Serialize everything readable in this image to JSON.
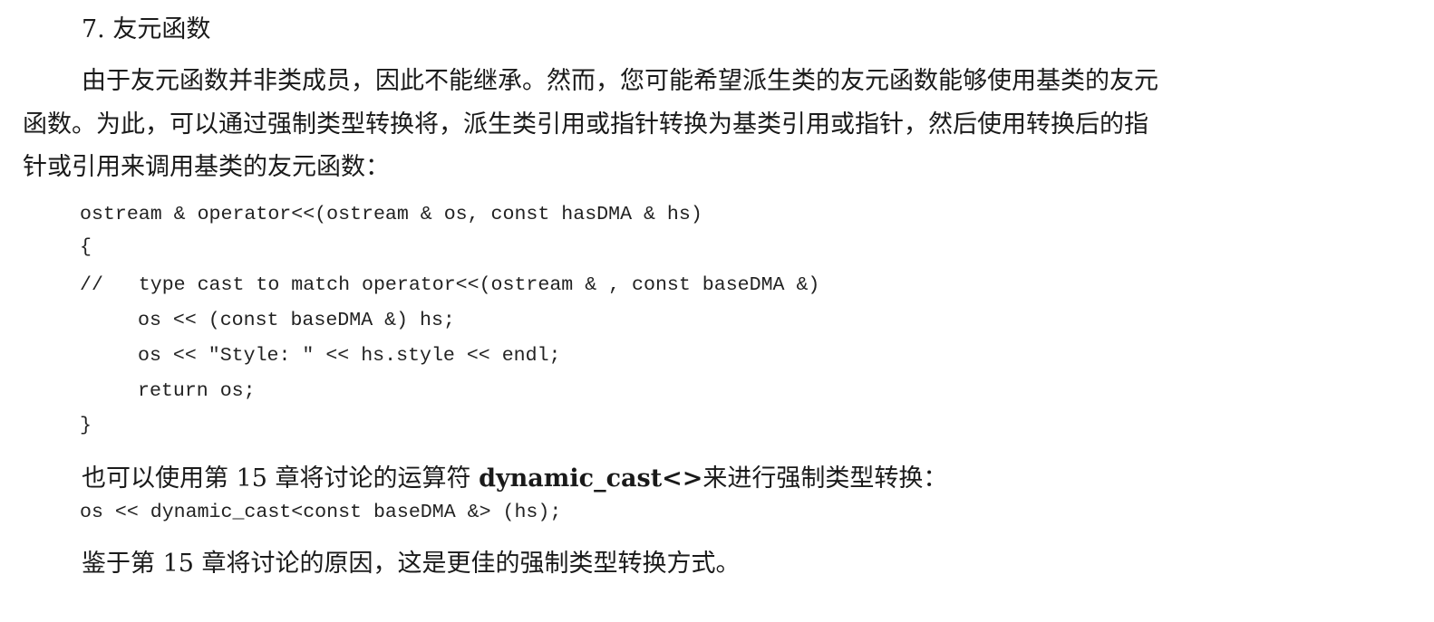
{
  "heading": "7. 友元函数",
  "paragraph1": {
    "line1": "由于友元函数并非类成员，因此不能继承。然而，您可能希望派生类的友元函数能够使用基类的友元",
    "line2": "函数。为此，可以通过强制类型转换将，派生类引用或指针转换为基类引用或指针，然后使用转换后的指",
    "line3": "针或引用来调用基类的友元函数："
  },
  "code_block": [
    "ostream & operator<<(ostream & os, const hasDMA & hs)",
    "{",
    "//   type cast to match operator<<(ostream & , const baseDMA &)",
    "os << (const baseDMA &) hs;",
    "os << \"Style: \" << hs.style << endl;",
    "return os;",
    "}"
  ],
  "paragraph2": {
    "before": "也可以使用第 15 章将讨论的运算符 ",
    "keyword": "dynamic_cast<>",
    "after": "来进行强制类型转换："
  },
  "code_line2": "os << dynamic_cast<const baseDMA &> (hs);",
  "paragraph3": "鉴于第 15 章将讨论的原因，这是更佳的强制类型转换方式。"
}
